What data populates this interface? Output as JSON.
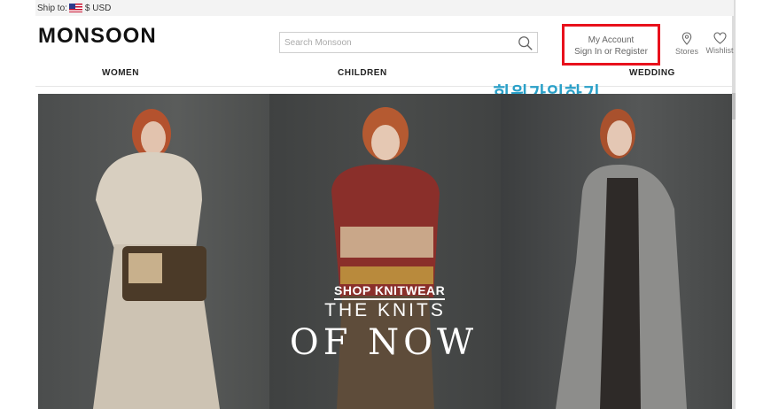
{
  "shipbar": {
    "ship_to_label": "Ship to:",
    "currency": "$ USD"
  },
  "header": {
    "logo": "MONSOON",
    "search_placeholder": "Search Monsoon",
    "account_title": "My Account",
    "account_subtitle": "Sign In or Register",
    "stores_label": "Stores",
    "wishlist_label": "Wishlist"
  },
  "nav": {
    "items": [
      "WOMEN",
      "CHILDREN",
      "WEDDING"
    ]
  },
  "annotation": {
    "text": "회원가입하기",
    "color": "#2aa0c8",
    "box_color": "#e8111c"
  },
  "hero": {
    "line1": "THE KNITS",
    "line2": "OF NOW",
    "cta": "SHOP KNITWEAR"
  },
  "icons": {
    "flag": "us-flag-icon",
    "search": "search-icon",
    "stores": "location-pin-icon",
    "wishlist": "heart-icon"
  }
}
